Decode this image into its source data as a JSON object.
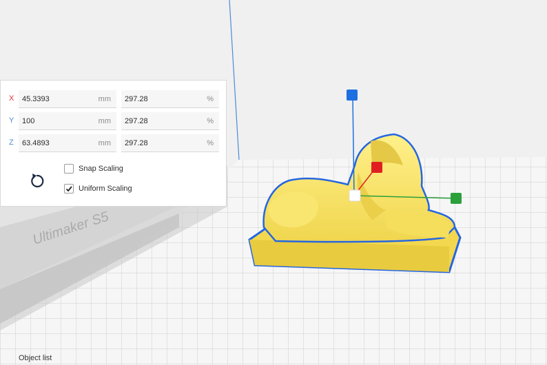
{
  "colors": {
    "axis_x": "#e03131",
    "axis_y": "#4a8ad6",
    "axis_z": "#4a8ad6",
    "gizmo_z": "#1c6fe0",
    "gizmo_x": "#e02020",
    "gizmo_y": "#2aa03a",
    "model": "#f7e26b",
    "model_outline": "#2566e0",
    "grid": "#c8c8c8",
    "build_plate": "#f5f5f5"
  },
  "scale_panel": {
    "rows": [
      {
        "axis": "X",
        "mm": "45.3393",
        "mm_unit": "mm",
        "pct": "297.28",
        "pct_unit": "%"
      },
      {
        "axis": "Y",
        "mm": "100",
        "mm_unit": "mm",
        "pct": "297.28",
        "pct_unit": "%"
      },
      {
        "axis": "Z",
        "mm": "63.4893",
        "mm_unit": "mm",
        "pct": "297.28",
        "pct_unit": "%"
      }
    ],
    "snap_scaling": {
      "label": "Snap Scaling",
      "checked": false
    },
    "uniform_scaling": {
      "label": "Uniform Scaling",
      "checked": true
    },
    "reset_icon": "reset-icon"
  },
  "printer_label": "Ultimaker S5",
  "footer": {
    "object_list_label": "Object list"
  }
}
